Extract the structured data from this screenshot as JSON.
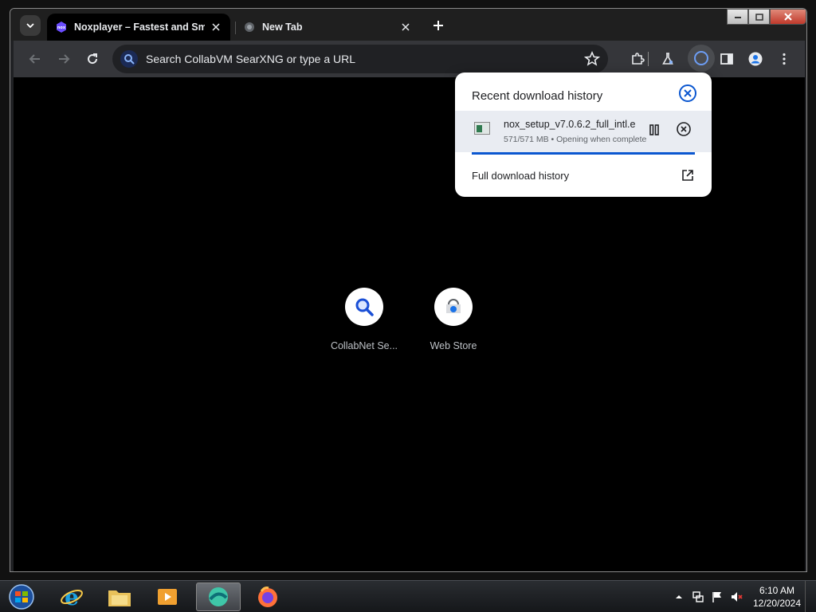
{
  "browser": {
    "tabs": [
      {
        "title": "Noxplayer – Fastest and Smoot",
        "active": true
      },
      {
        "title": "New Tab",
        "active": false
      }
    ],
    "omnibox_placeholder": "Search CollabVM SearXNG or type a URL"
  },
  "shortcuts": [
    {
      "label": "CollabNet Se...",
      "icon": "search-icon"
    },
    {
      "label": "Web Store",
      "icon": "web-store-icon"
    }
  ],
  "downloads_popup": {
    "title": "Recent download history",
    "file_name": "nox_setup_v7.0.6.2_full_intl.e",
    "status": "571/571 MB • Opening when complete",
    "progress": 1.0,
    "full_history_label": "Full download history"
  },
  "taskbar": {
    "apps": [
      "internet-explorer",
      "file-explorer",
      "media-player",
      "browser",
      "firefox"
    ],
    "time": "6:10 AM",
    "date": "12/20/2024"
  },
  "colors": {
    "accent": "#0b57d0",
    "toolbar": "#35363a",
    "content_bg": "#000000"
  }
}
